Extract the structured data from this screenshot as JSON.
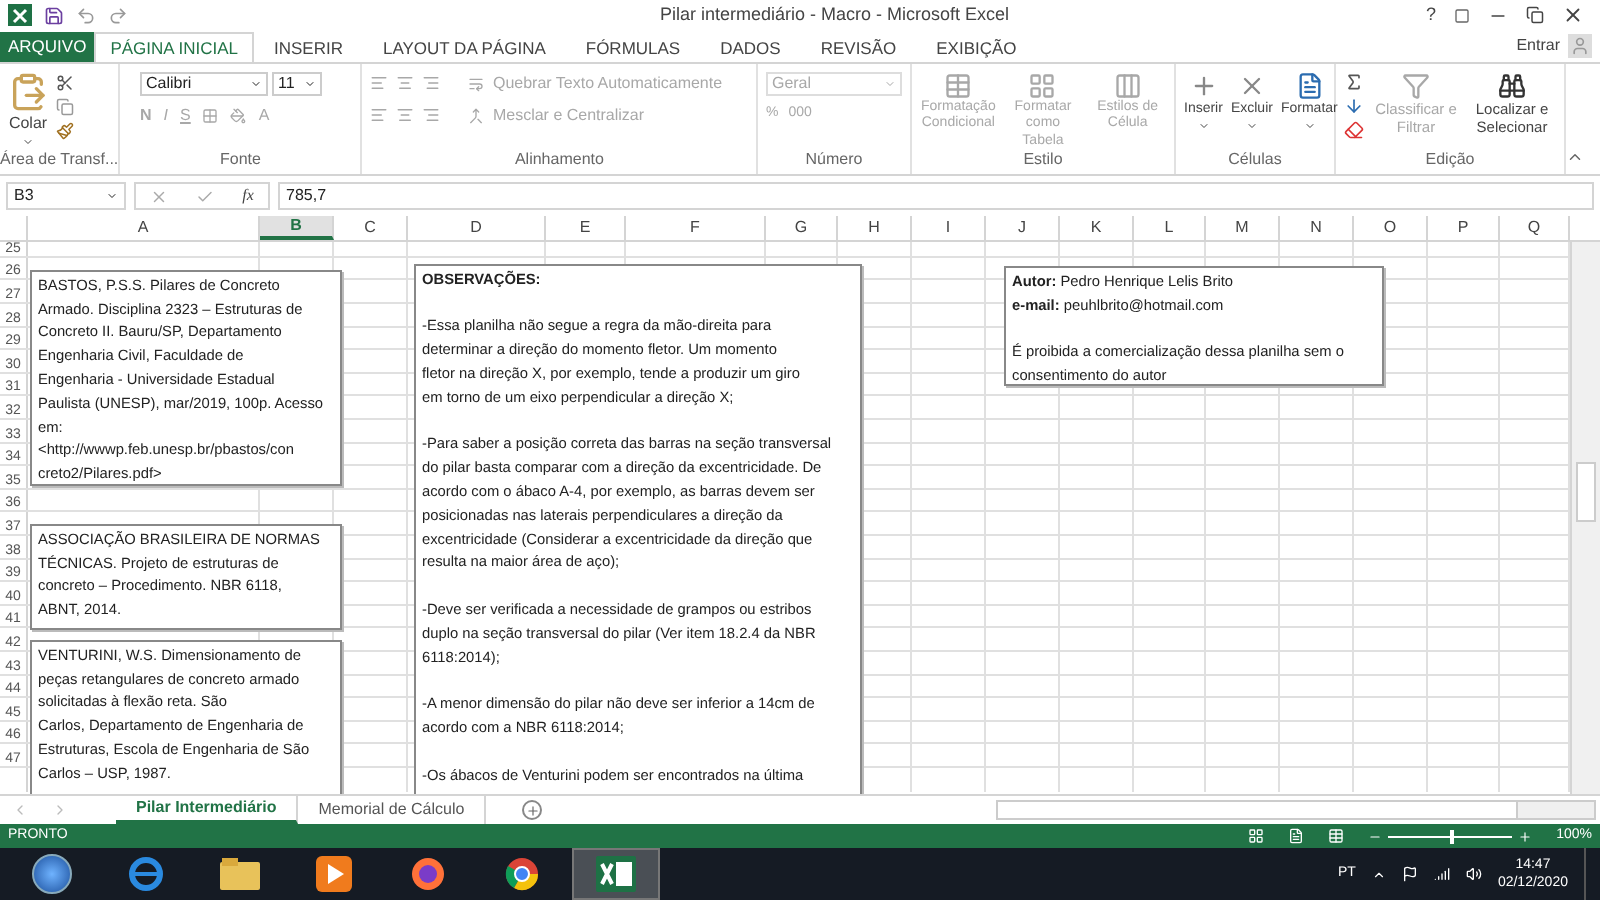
{
  "window": {
    "title": "Pilar intermediário - Macro - Microsoft Excel",
    "help": "?"
  },
  "tabs": [
    {
      "label": "ARQUIVO",
      "kind": "file",
      "selected": false
    },
    {
      "label": "PÁGINA INICIAL",
      "kind": "tab",
      "selected": true
    },
    {
      "label": "INSERIR",
      "kind": "tab",
      "selected": false
    },
    {
      "label": "LAYOUT DA PÁGINA",
      "kind": "tab",
      "selected": false
    },
    {
      "label": "FÓRMULAS",
      "kind": "tab",
      "selected": false
    },
    {
      "label": "DADOS",
      "kind": "tab",
      "selected": false
    },
    {
      "label": "REVISÃO",
      "kind": "tab",
      "selected": false
    },
    {
      "label": "EXIBIÇÃO",
      "kind": "tab",
      "selected": false
    }
  ],
  "account": {
    "label": "Entrar"
  },
  "ribbon": {
    "clipboard": {
      "label": "Área de Transf...",
      "paste": "Colar"
    },
    "font": {
      "label": "Fonte",
      "font_name": "Calibri",
      "font_size": "11",
      "bold": "N",
      "italic": "I",
      "underline": "S",
      "font_color": "A",
      "disabled": true
    },
    "alignment": {
      "label": "Alinhamento",
      "wrap_text": "Quebrar Texto Automaticamente",
      "merge": "Mesclar e Centralizar",
      "disabled": true
    },
    "number": {
      "label": "Número",
      "format": "Geral",
      "percent": "%",
      "thousands": "000",
      "disabled": true
    },
    "styles": {
      "label": "Estilo",
      "disabled": true,
      "buttons": [
        "Formatação Condicional",
        "Formatar como Tabela",
        "Estilos de Célula"
      ]
    },
    "cells": {
      "label": "Células",
      "buttons": [
        "Inserir",
        "Excluir",
        "Formatar"
      ]
    },
    "editing": {
      "label": "Edição",
      "buttons": [
        {
          "label": "Classificar e Filtrar",
          "disabled": true
        },
        {
          "label": "Localizar e Selecionar",
          "disabled": false
        }
      ]
    }
  },
  "formula_bar": {
    "name_box": "B3",
    "function_label": "fx",
    "value": "785,7"
  },
  "columns": [
    {
      "label": "A",
      "selected": false
    },
    {
      "label": "B",
      "selected": true
    },
    {
      "label": "C",
      "selected": false
    },
    {
      "label": "D",
      "selected": false
    },
    {
      "label": "E",
      "selected": false
    },
    {
      "label": "F",
      "selected": false
    },
    {
      "label": "G",
      "selected": false
    },
    {
      "label": "H",
      "selected": false
    },
    {
      "label": "I",
      "selected": false
    },
    {
      "label": "J",
      "selected": false
    },
    {
      "label": "K",
      "selected": false
    },
    {
      "label": "L",
      "selected": false
    },
    {
      "label": "M",
      "selected": false
    },
    {
      "label": "N",
      "selected": false
    },
    {
      "label": "O",
      "selected": false
    },
    {
      "label": "P",
      "selected": false
    },
    {
      "label": "Q",
      "selected": false
    }
  ],
  "rows": [
    "25",
    "26",
    "27",
    "28",
    "29",
    "30",
    "31",
    "32",
    "33",
    "34",
    "35",
    "36",
    "37",
    "38",
    "39",
    "40",
    "41",
    "42",
    "43",
    "44",
    "45",
    "46",
    "47"
  ],
  "text_boxes": [
    {
      "paragraphs": [
        {
          "kind": "text",
          "lines": [
            "BASTOS, P.S.S. Pilares de Concreto",
            "Armado. Disciplina 2323 – Estruturas de",
            "Concreto II. Bauru/SP, Departamento",
            "Engenharia Civil, Faculdade de",
            "Engenharia - Universidade Estadual",
            "Paulista (UNESP), mar/2019, 100p. Acesso",
            "em:",
            "<http://wwwp.feb.unesp.br/pbastos/con",
            "creto2/Pilares.pdf>"
          ]
        }
      ]
    },
    {
      "paragraphs": [
        {
          "kind": "text",
          "lines": [
            "ASSOCIAÇÃO BRASILEIRA DE NORMAS",
            "TÉCNICAS. Projeto de estruturas de",
            "concreto – Procedimento. NBR 6118,",
            "ABNT, 2014."
          ]
        }
      ]
    },
    {
      "paragraphs": [
        {
          "kind": "text",
          "lines": [
            "VENTURINI, W.S. Dimensionamento de",
            "peças retangulares de concreto armado",
            "solicitadas à flexão reta. São",
            "Carlos, Departamento de Engenharia de",
            "Estruturas, Escola de Engenharia de São",
            "Carlos – USP, 1987."
          ]
        }
      ]
    },
    {
      "paragraphs": [
        {
          "kind": "heading",
          "lines": [
            "OBSERVAÇÕES:"
          ]
        },
        {
          "kind": "text",
          "lines": [
            "-Essa planilha não segue a regra da mão-direita para",
            "determinar a direção do momento fletor. Um momento",
            "fletor na direção X, por exemplo, tende a produzir um giro",
            "em torno de um eixo perpendicular a direção X;"
          ]
        },
        {
          "kind": "text",
          "lines": [
            "-Para saber a posição correta das barras na seção transversal",
            "do pilar basta comparar com a direção da excentricidade. De",
            "acordo com o ábaco A-4, por exemplo, as barras devem ser",
            "posicionadas nas laterais perpendiculares a direção da",
            "excentricidade (Considerar a excentricidade da direção que",
            "resulta na maior área de aço);"
          ]
        },
        {
          "kind": "text",
          "lines": [
            "-Deve ser verificada a necessidade de grampos ou estribos",
            "duplo na seção transversal do pilar (Ver item 18.2.4 da NBR",
            "6118:2014);"
          ]
        },
        {
          "kind": "text",
          "lines": [
            "-A menor dimensão do pilar não deve ser inferior a 14cm de",
            "acordo com a NBR 6118:2014;"
          ]
        },
        {
          "kind": "text",
          "lines": [
            "-Os ábacos de Venturini podem ser encontrados na última"
          ]
        }
      ]
    },
    {
      "paragraphs": [
        {
          "kind": "text",
          "lines": [
            "**Autor:** Pedro Henrique Lelis Brito",
            "**e-mail:** peuhlbrito@hotmail.com"
          ]
        },
        {
          "kind": "text",
          "lines": [
            "É proibida a comercialização dessa planilha sem o",
            "consentimento do autor"
          ]
        }
      ]
    }
  ],
  "sheets": [
    {
      "label": "Pilar Intermediário",
      "selected": true
    },
    {
      "label": "Memorial de Cálculo",
      "selected": false
    }
  ],
  "status_bar": {
    "status": "PRONTO",
    "zoom": "100%",
    "level": 0.5
  },
  "taskbar": {
    "apps": [
      {
        "kind": "start",
        "selected": false
      },
      {
        "kind": "e-browser",
        "selected": false
      },
      {
        "kind": "folder",
        "selected": false
      },
      {
        "kind": "player",
        "selected": false
      },
      {
        "kind": "fox-browser",
        "selected": false
      },
      {
        "kind": "round-browser",
        "selected": false
      },
      {
        "kind": "spreadsheet",
        "selected": true
      }
    ],
    "language": "PT",
    "time": "14:47",
    "date": "02/12/2020"
  }
}
